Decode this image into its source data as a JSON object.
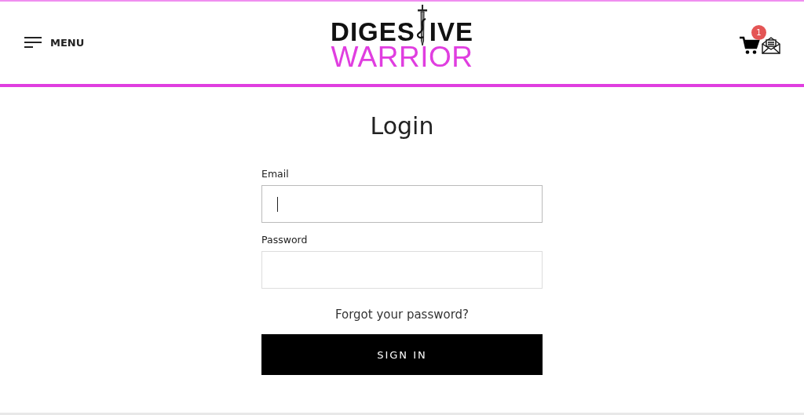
{
  "header": {
    "menu_label": "MENU",
    "logo": {
      "top_left": "DIGES",
      "top_right": "IVE",
      "bottom": "WARRIOR"
    },
    "cart_count": "1"
  },
  "form": {
    "title": "Login",
    "fields": [
      {
        "label": "Email",
        "focused": true
      },
      {
        "label": "Password",
        "focused": false
      }
    ],
    "forgot_link": "Forgot your password?",
    "submit": "SIGN IN"
  }
}
